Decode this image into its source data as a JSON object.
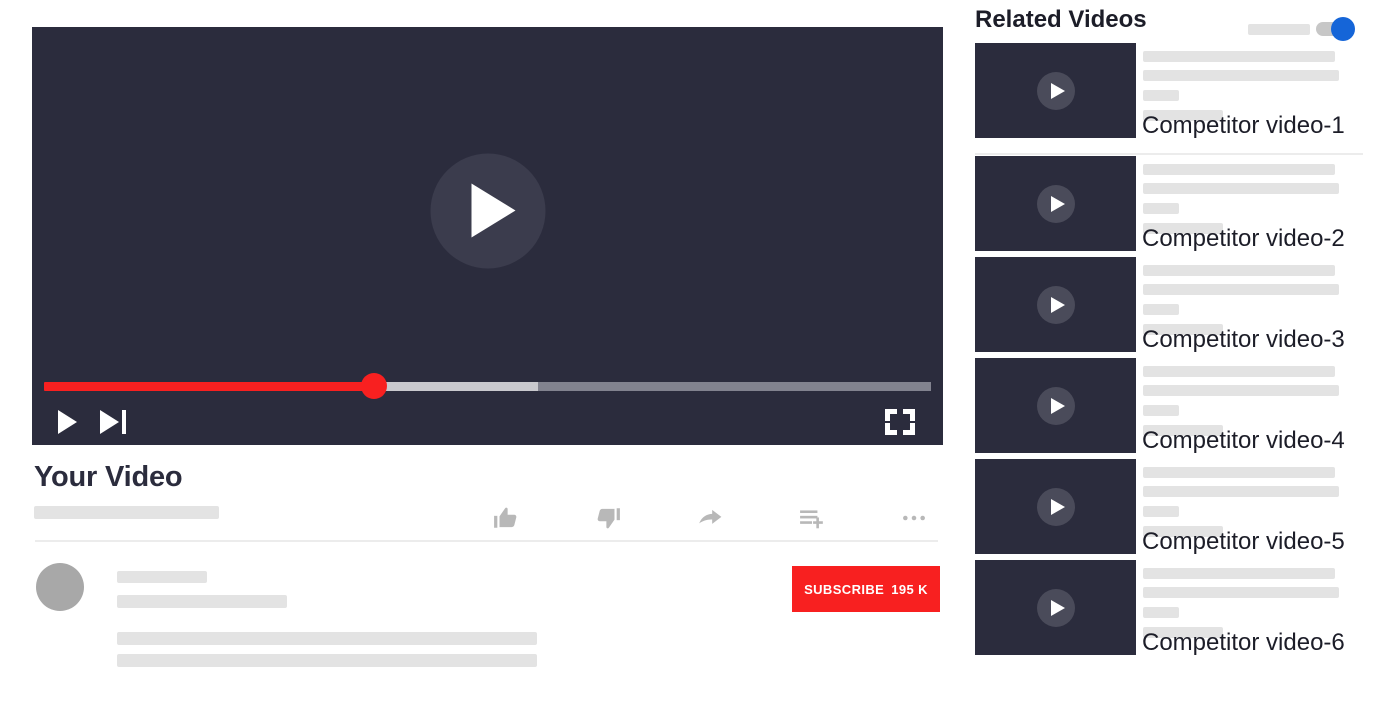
{
  "player": {
    "big_play_icon": "play-icon",
    "progress": {
      "played_percent": 37.2,
      "buffered_percent": 55.7,
      "played_color": "#f82020",
      "buffered_color": "#c9c9ce",
      "remaining_color": "#82838f"
    },
    "controls": [
      {
        "name": "play-button",
        "icon": "play-icon"
      },
      {
        "name": "next-button",
        "icon": "skip-next-icon"
      },
      {
        "name": "fullscreen-button",
        "icon": "fullscreen-icon"
      }
    ]
  },
  "video": {
    "title": "Your Video",
    "actions": [
      {
        "name": "like-button",
        "icon": "thumbs-up-icon"
      },
      {
        "name": "dislike-button",
        "icon": "thumbs-down-icon"
      },
      {
        "name": "share-button",
        "icon": "share-arrow-icon"
      },
      {
        "name": "save-button",
        "icon": "add-to-playlist-icon"
      },
      {
        "name": "more-button",
        "icon": "more-horizontal-icon"
      }
    ],
    "subscribe_label": "SUBSCRIBE",
    "subscriber_count": "195 K",
    "subscribe_color": "#f82020"
  },
  "related": {
    "heading": "Related Videos",
    "toggle": {
      "state": "on",
      "accent": "#1565d8"
    },
    "items": [
      {
        "title": "Competitor video-1",
        "thumb_icon": "play-icon"
      },
      {
        "title": "Competitor video-2",
        "thumb_icon": "play-icon"
      },
      {
        "title": "Competitor video-3",
        "thumb_icon": "play-icon"
      },
      {
        "title": "Competitor video-4",
        "thumb_icon": "play-icon"
      },
      {
        "title": "Competitor video-5",
        "thumb_icon": "play-icon"
      },
      {
        "title": "Competitor video-6",
        "thumb_icon": "play-icon"
      }
    ]
  }
}
